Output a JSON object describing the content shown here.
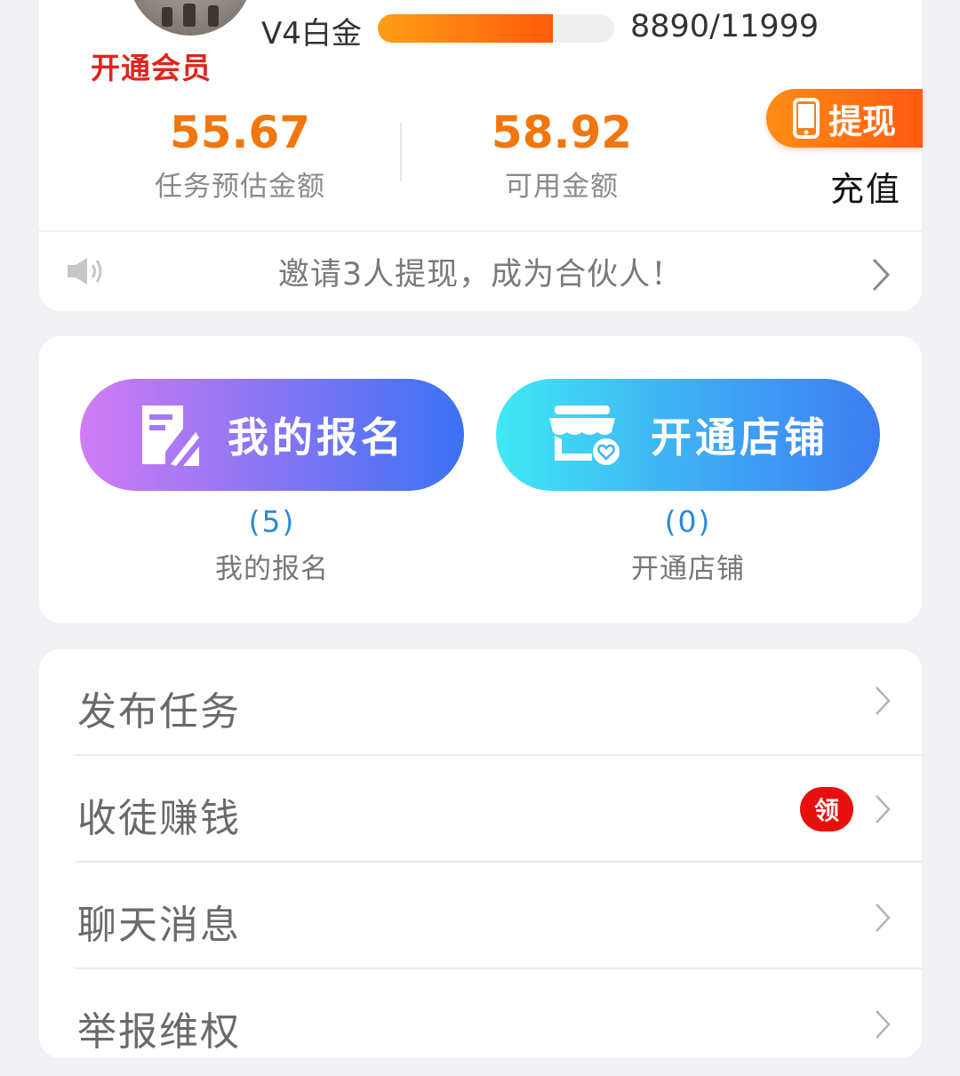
{
  "profile": {
    "vip_link": "开通会员",
    "level_name": "V4白金",
    "level_progress_fraction": 0.741,
    "level_progress_text": "8890/11999"
  },
  "wallet": {
    "task_estimate_amount": "55.67",
    "task_estimate_label": "任务预估金额",
    "available_amount": "58.92",
    "available_label": "可用金额",
    "withdraw_label": "提现",
    "recharge_label": "充值"
  },
  "notice": {
    "text": "邀请3人提现，成为合伙人！"
  },
  "actions": [
    {
      "title": "我的报名",
      "count": "(5)",
      "label": "我的报名"
    },
    {
      "title": "开通店铺",
      "count": "(0)",
      "label": "开通店铺"
    }
  ],
  "menu": [
    {
      "label": "发布任务"
    },
    {
      "label": "收徒赚钱",
      "badge": "领"
    },
    {
      "label": "聊天消息"
    },
    {
      "label": "举报维权"
    }
  ],
  "colors": {
    "accent_orange": "#f2760e",
    "vip_red": "#e0251c",
    "count_blue": "#2a8ad9",
    "badge_red": "#e8100d",
    "page_background": "#f1f0f5"
  },
  "icons": [
    "speaker-icon",
    "chevron-right-icon",
    "phone-icon",
    "signup-form-icon",
    "shop-icon"
  ]
}
